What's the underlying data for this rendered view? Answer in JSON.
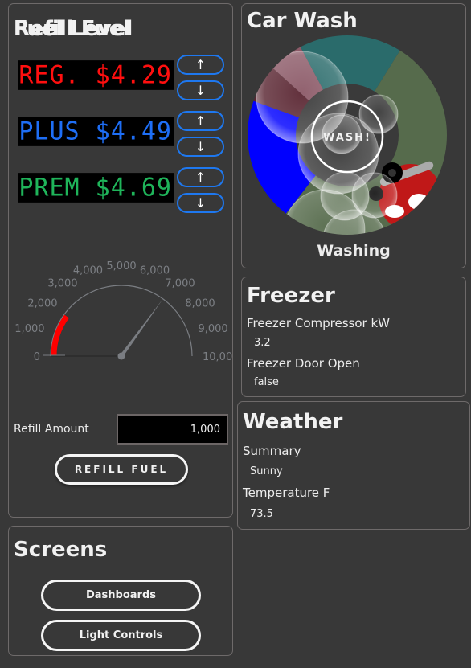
{
  "fuel": {
    "title": "Fuel",
    "prices": [
      {
        "label": "REG. $4.29",
        "grade": "REG.",
        "price": "$4.29",
        "color": "#ff0f0f"
      },
      {
        "label": "PLUS $4.49",
        "grade": "PLUS",
        "price": "$4.49",
        "color": "#1e6ef5"
      },
      {
        "label": "PREM $4.69",
        "grade": "PREM",
        "price": "$4.69",
        "color": "#1fb45a"
      }
    ],
    "up_glyph": "↑",
    "down_glyph": "↓",
    "button_color": "#1e78f0",
    "level": {
      "title": "Fuel Level",
      "min": 0,
      "max": 10000,
      "value": 7000,
      "low_zone": [
        0,
        2000
      ],
      "low_zone_color": "#ff0000",
      "tick_labels": [
        "0",
        "1,000",
        "2,000",
        "3,000",
        "4,000",
        "5,000",
        "6,000",
        "7,000",
        "8,000",
        "9,000",
        "10,00"
      ]
    },
    "refill": {
      "title": "Refill Fuel",
      "amount_label": "Refill Amount",
      "amount_value": "1,000",
      "button_label": "REFILL FUEL"
    }
  },
  "screens": {
    "title": "Screens",
    "buttons": [
      "Dashboards",
      "Light Controls"
    ]
  },
  "car_wash": {
    "title": "Car Wash",
    "button_label": "WASH!",
    "status": "Washing",
    "segment_colors": [
      "#2a6b6b",
      "#566b4c",
      "#0000ff",
      "#5a2632",
      "#8c5a68"
    ]
  },
  "freezer": {
    "title": "Freezer",
    "fields": [
      {
        "label": "Freezer Compressor kW",
        "value": "3.2"
      },
      {
        "label": "Freezer Door Open",
        "value": "false"
      }
    ]
  },
  "weather": {
    "title": "Weather",
    "fields": [
      {
        "label": "Summary",
        "value": "Sunny"
      },
      {
        "label": "Temperature F",
        "value": "73.5"
      }
    ]
  }
}
